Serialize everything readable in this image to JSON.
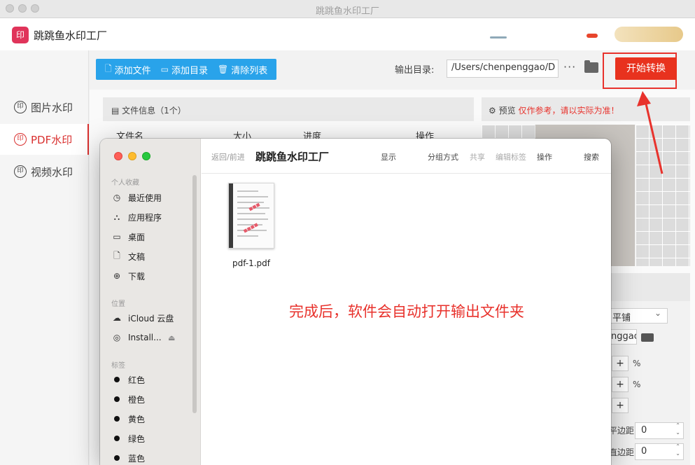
{
  "window": {
    "title": "跳跳鱼水印工厂"
  },
  "app": {
    "logo_text": "印",
    "name": "跳跳鱼水印工厂"
  },
  "sidebar": {
    "items": [
      {
        "label": "图片水印",
        "icon": "印",
        "active": false
      },
      {
        "label": "PDF水印",
        "icon": "印",
        "active": true
      },
      {
        "label": "视频水印",
        "icon": "印",
        "active": false
      }
    ]
  },
  "toolbar": {
    "add_file": "添加文件",
    "add_dir": "添加目录",
    "clear_list": "清除列表",
    "output_label": "输出目录:",
    "output_path": "/Users/chenpenggao/D",
    "more": "···",
    "start": "开始转换"
  },
  "file_panel": {
    "title": "文件信息（1个）",
    "columns": [
      "文件名",
      "大小",
      "进度",
      "操作"
    ]
  },
  "preview": {
    "label": "预览",
    "note": "仅作参考，请以实际为准！"
  },
  "settings": {
    "mode": "平铺",
    "path_partial": "nggao",
    "pct1": "%",
    "pct2": "%",
    "label1": "平边距",
    "label2": "直边距",
    "value1": "0",
    "value2": "0"
  },
  "finder": {
    "nav": "返回/前进",
    "title": "跳跳鱼水印工厂",
    "toolbar": [
      "显示",
      "分组方式",
      "共享",
      "编辑标签",
      "操作",
      "搜索"
    ],
    "sections": {
      "favorites": "个人收藏",
      "locations": "位置",
      "tags": "标签"
    },
    "favorites": [
      "最近使用",
      "应用程序",
      "桌面",
      "文稿",
      "下载"
    ],
    "locations": [
      "iCloud 云盘",
      "Install..."
    ],
    "tags": [
      "红色",
      "橙色",
      "黄色",
      "绿色",
      "蓝色"
    ],
    "file": {
      "name": "pdf-1.pdf"
    },
    "annotation": "完成后，软件会自动打开输出文件夹"
  },
  "colors": {
    "accent": "#e8321e",
    "toolbar_blue": "#29a3ea"
  }
}
